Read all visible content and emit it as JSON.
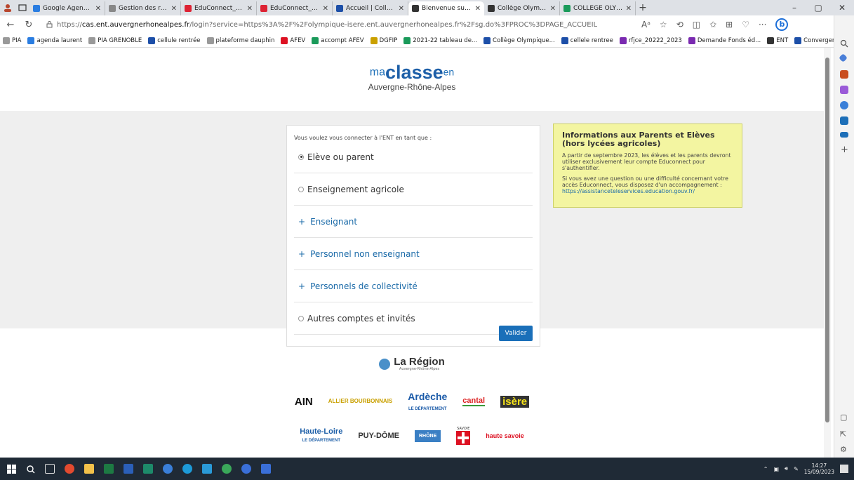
{
  "tabs": [
    {
      "label": "Google Agenda - Semaine",
      "icon": "google-calendar-icon",
      "color": "#2a7de1"
    },
    {
      "label": "Gestion des représentants",
      "icon": "page-icon",
      "color": "#888888"
    },
    {
      "label": "EduConnect_CourrierResp",
      "icon": "pdf-icon",
      "color": "#d23"
    },
    {
      "label": "EduConnect_CourrierResp",
      "icon": "pdf-icon",
      "color": "#d23"
    },
    {
      "label": "Accueil | Collège Olympique",
      "icon": "marianne-icon",
      "color": "#1d4fa8"
    },
    {
      "label": "Bienvenue sur votre Environ",
      "icon": "ent-icon",
      "color": "#333",
      "active": true
    },
    {
      "label": "Collège Olympique",
      "icon": "ent-icon",
      "color": "#333"
    },
    {
      "label": "COLLEGE OLYMPIQUE - PI",
      "icon": "pi-icon",
      "color": "#1a9a5a"
    }
  ],
  "address": {
    "url_prefix": "https://",
    "host": "cas.ent.auvergnerhonealpes.fr",
    "path": "/login?service=https%3A%2F%2Folympique-isere.ent.auvergnerhonealpes.fr%2Fsg.do%3FPROC%3DPAGE_ACCUEIL"
  },
  "bookmarks": [
    {
      "label": "PIA",
      "color": "#999"
    },
    {
      "label": "agenda laurent",
      "color": "#2a7de1"
    },
    {
      "label": "PIA GRENOBLE",
      "color": "#999"
    },
    {
      "label": "cellule rentrée",
      "color": "#1d4fa8"
    },
    {
      "label": "plateforme dauphin",
      "color": "#999"
    },
    {
      "label": "AFEV",
      "color": "#d12"
    },
    {
      "label": "accompt AFEV",
      "color": "#1a9a5a"
    },
    {
      "label": "DGFIP",
      "color": "#caa000"
    },
    {
      "label": "2021-22 tableau de...",
      "color": "#1a9a5a"
    },
    {
      "label": "Collège Olympique...",
      "color": "#1d4fa8"
    },
    {
      "label": "cellele rentree",
      "color": "#1d4fa8"
    },
    {
      "label": "rfjce_20222_2023",
      "color": "#7a2ab0"
    },
    {
      "label": "Demande Fonds éd...",
      "color": "#7a2ab0"
    },
    {
      "label": "ENT",
      "color": "#333"
    },
    {
      "label": "Convergence",
      "color": "#1d4fa8"
    }
  ],
  "brand": {
    "ma": "ma",
    "classe": "classe",
    "en": "en",
    "region": "Auvergne-Rhône-Alpes"
  },
  "login": {
    "intro": "Vous voulez vous connecter à l'ENT en tant que :",
    "options": [
      {
        "label": "Elève ou parent",
        "type": "radio",
        "checked": true
      },
      {
        "label": "Enseignement agricole",
        "type": "radio",
        "checked": false
      },
      {
        "label": "Enseignant",
        "type": "expand"
      },
      {
        "label": "Personnel non enseignant",
        "type": "expand"
      },
      {
        "label": "Personnels de collectivité",
        "type": "expand"
      },
      {
        "label": "Autres comptes et invités",
        "type": "radio",
        "checked": false
      }
    ],
    "submit": "Valider"
  },
  "info": {
    "title": "Informations aux Parents et Elèves (hors lycées agricoles)",
    "p1": "A partir de septembre 2023, les élèves et les parents devront utiliser exclusivement leur compte Educonnect pour s'authentifier.",
    "p2": "Si vous avez une question ou une difficulté concernant votre accès Educonnect, vous disposez d'un accompagnement :",
    "link": "https://assistanceteleservices.education.gouv.fr/"
  },
  "footer": {
    "region_title": "La Région",
    "region_sub": "Auvergne-Rhône-Alpes",
    "departments_row1": [
      "AIN",
      "ALLIER BOURBONNAIS",
      "Ardèche",
      "cantal",
      "isère"
    ],
    "departments_row2": [
      "Haute-Loire",
      "PUY-DÔME",
      "RHÔNE",
      "SAVOIE",
      "haute savoie"
    ],
    "haute_loire_sub": "LE DÉPARTEMENT",
    "ardeche_sub": "LE DÉPARTEMENT"
  },
  "taskbar": {
    "time": "14:27",
    "date": "15/09/2023"
  }
}
